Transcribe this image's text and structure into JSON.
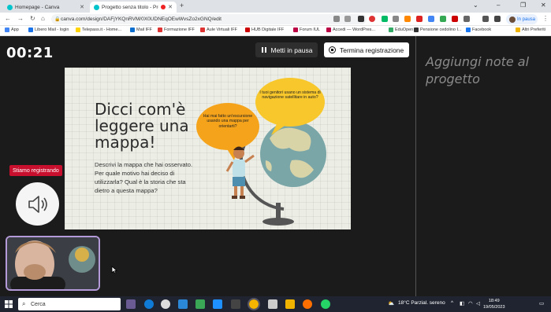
{
  "browser": {
    "tabs": [
      {
        "title": "Homepage - Canva",
        "active": false
      },
      {
        "title": "Progetto senza titolo - Prev",
        "active": true,
        "recording": true
      }
    ],
    "url": "canva.com/design/DAFjYKQnRVM/0X0UDNEqOEwWvsZo2xGNQ/edit",
    "pause_button": "In pausa",
    "bookmarks": [
      {
        "label": "App",
        "icon": "apps-grid-icon",
        "color": "#4285f4"
      },
      {
        "label": "Libero Mail - login",
        "icon": "libero-icon",
        "color": "#1a73e8"
      },
      {
        "label": "Telepass.it - Home...",
        "icon": "telepass-icon",
        "color": "#ffd400"
      },
      {
        "label": "Mail IFF",
        "icon": "mail-icon",
        "color": "#0b6ecf"
      },
      {
        "label": "Formazione IFF",
        "icon": "iff-icon",
        "color": "#d33"
      },
      {
        "label": "Aule Virtuali IFF",
        "icon": "iff-icon",
        "color": "#d33"
      },
      {
        "label": "HUB Digitale IFF",
        "icon": "hub-icon",
        "color": "#c00"
      },
      {
        "label": "Forum IUL",
        "icon": "forum-icon",
        "color": "#b04"
      },
      {
        "label": "Accedi — WordPres...",
        "icon": "wordpress-icon",
        "color": "#b04"
      },
      {
        "label": "EduOpen",
        "icon": "eduopen-icon",
        "color": "#3a6"
      },
      {
        "label": "Pensione cedolino I...",
        "icon": "inps-icon",
        "color": "#333"
      },
      {
        "label": "Facebook",
        "icon": "facebook-icon",
        "color": "#1877f2"
      },
      {
        "label": "Altri Preferiti",
        "icon": "folder-icon",
        "color": "#f0b400"
      }
    ]
  },
  "recorder": {
    "timer": "00:21",
    "pause_label": "Metti in pausa",
    "stop_label": "Termina registrazione",
    "notes_placeholder": "Aggiungi note al progetto",
    "recording_badge": "Stiamo registrando"
  },
  "slide": {
    "title": "Dicci com'è leggere una mappa!",
    "body": "Descrivi la mappa che hai osservato. Per quale motivo hai deciso di utilizzarla? Qual è la storia che sta dietro a questa mappa?",
    "bubble_left": "Hai mai fatto un'escursione usando una mappa per orientarti?",
    "bubble_right": "I tuoi genitori usano un sistema di navigazione satellitare in auto?",
    "colors": {
      "bubble_left": "#f5a31a",
      "bubble_right": "#f7c72b",
      "globe": "#7aa6a8",
      "land": "#d8d4a8"
    }
  },
  "taskbar": {
    "search_placeholder": "Cerca",
    "weather": "18°C  Parzial. sereno",
    "time": "18:49",
    "date": "19/05/2023"
  }
}
